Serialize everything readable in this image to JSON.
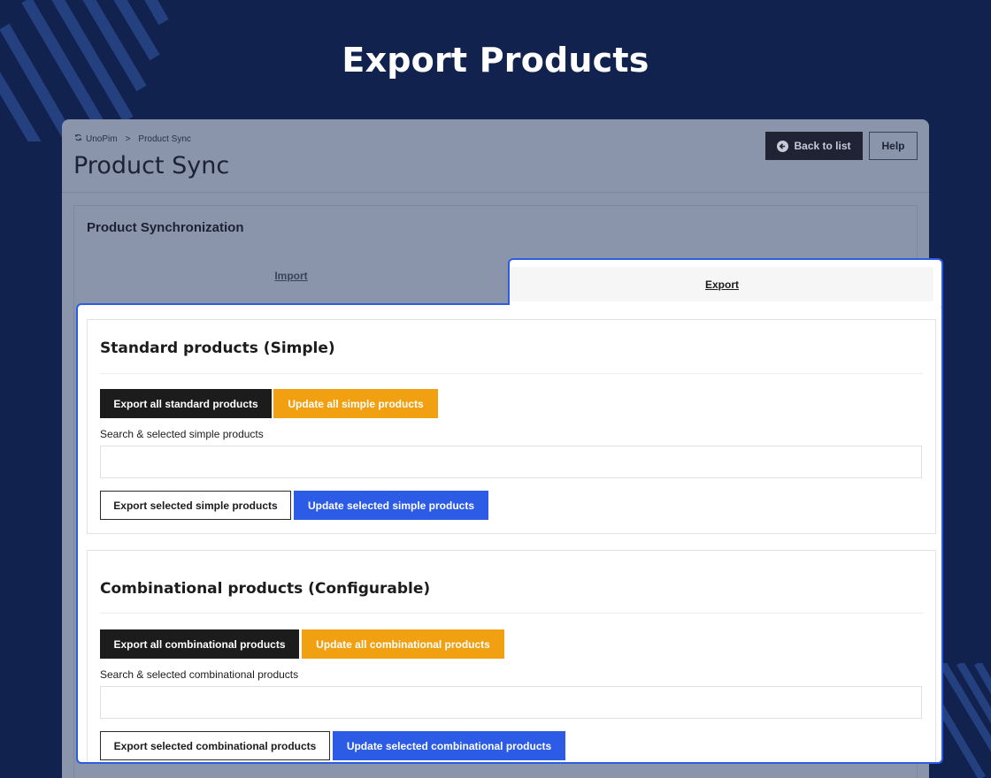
{
  "hero": {
    "title": "Export Products"
  },
  "header": {
    "breadcrumb": {
      "root": "UnoPim",
      "separator": ">",
      "current": "Product Sync"
    },
    "page_title": "Product Sync",
    "back_label": "Back to list",
    "help_label": "Help"
  },
  "sync": {
    "title": "Product Synchronization",
    "tabs": {
      "import": "Import",
      "export": "Export"
    }
  },
  "sections": {
    "simple": {
      "title": "Standard products (Simple)",
      "export_all": "Export all standard products",
      "update_all": "Update all simple products",
      "search_label": "Search & selected simple products",
      "search_value": "",
      "export_selected": "Export selected simple products",
      "update_selected": "Update selected simple products"
    },
    "configurable": {
      "title": "Combinational products (Configurable)",
      "export_all": "Export all combinational products",
      "update_all": "Update all combinational products",
      "search_label": "Search & selected combinational products",
      "search_value": "",
      "export_selected": "Export selected combinational products",
      "update_selected": "Update selected combinational products"
    }
  },
  "colors": {
    "background": "#12224f",
    "accent_blue": "#2c5be6",
    "accent_orange": "#f0a010",
    "dark_button": "#1c1c1c"
  },
  "icons": {
    "back": "arrow-left-circle-icon",
    "brand": "sync-icon"
  }
}
